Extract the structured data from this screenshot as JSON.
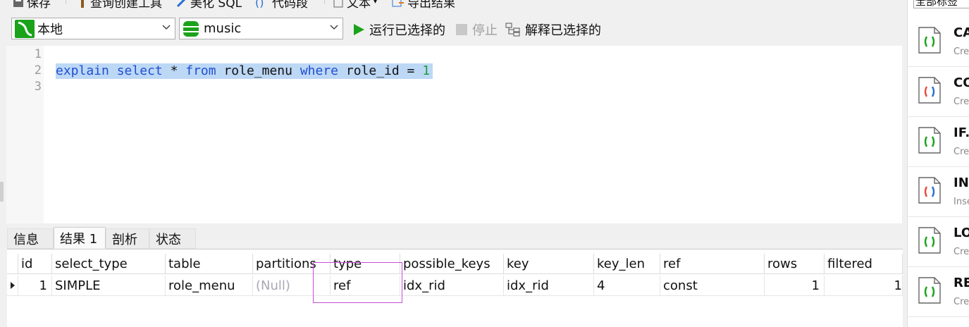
{
  "toolbar": {
    "save": "保存",
    "query_builder": "查询创建工具",
    "beautify": "美化 SQL",
    "snippet": "代码段",
    "text": "文本",
    "export": "导出结果"
  },
  "connection": {
    "selected": "本地"
  },
  "database": {
    "selected": "music"
  },
  "actions": {
    "run_selected": "运行已选择的",
    "stop": "停止",
    "explain_selected": "解释已选择的"
  },
  "editor": {
    "line_numbers": [
      "1",
      "2",
      "3"
    ],
    "tokens": {
      "t1": "explain",
      "t2": " ",
      "t3": "select",
      "t4": " * ",
      "t5": "from",
      "t6": " role_menu ",
      "t7": "where",
      "t8": " role_id = ",
      "t9": "1"
    }
  },
  "result_tabs": [
    "信息",
    "结果 1",
    "剖析",
    "状态"
  ],
  "grid": {
    "columns": [
      "id",
      "select_type",
      "table",
      "partitions",
      "type",
      "possible_keys",
      "key",
      "key_len",
      "ref",
      "rows",
      "filtered"
    ],
    "rows": [
      {
        "id": "1",
        "select_type": "SIMPLE",
        "table": "role_menu",
        "partitions": "(Null)",
        "type": "ref",
        "possible_keys": "idx_rid",
        "key": "idx_rid",
        "key_len": "4",
        "ref": "const",
        "rows": "1",
        "filtered": "1"
      }
    ]
  },
  "snippets": {
    "filter": "全部标签",
    "items": [
      {
        "title": "CA",
        "subtitle": "Cre",
        "icon": "snippet-doc-icon"
      },
      {
        "title": "CO",
        "subtitle": "Cre",
        "icon": "snippet-doc-icon"
      },
      {
        "title": "IF.",
        "subtitle": "Cre",
        "icon": "snippet-doc-icon"
      },
      {
        "title": "IN",
        "subtitle": "Inse",
        "icon": "snippet-doc-icon"
      },
      {
        "title": "LO",
        "subtitle": "Cre",
        "icon": "snippet-doc-icon"
      },
      {
        "title": "RE",
        "subtitle": "Cre",
        "icon": "snippet-doc-icon"
      }
    ]
  },
  "colors": {
    "keyword": "#1f4fd1",
    "number": "#1a9e3a",
    "selection": "#bdd8f5",
    "highlight_box": "#c44fd6",
    "run_green": "#1aa31a"
  }
}
